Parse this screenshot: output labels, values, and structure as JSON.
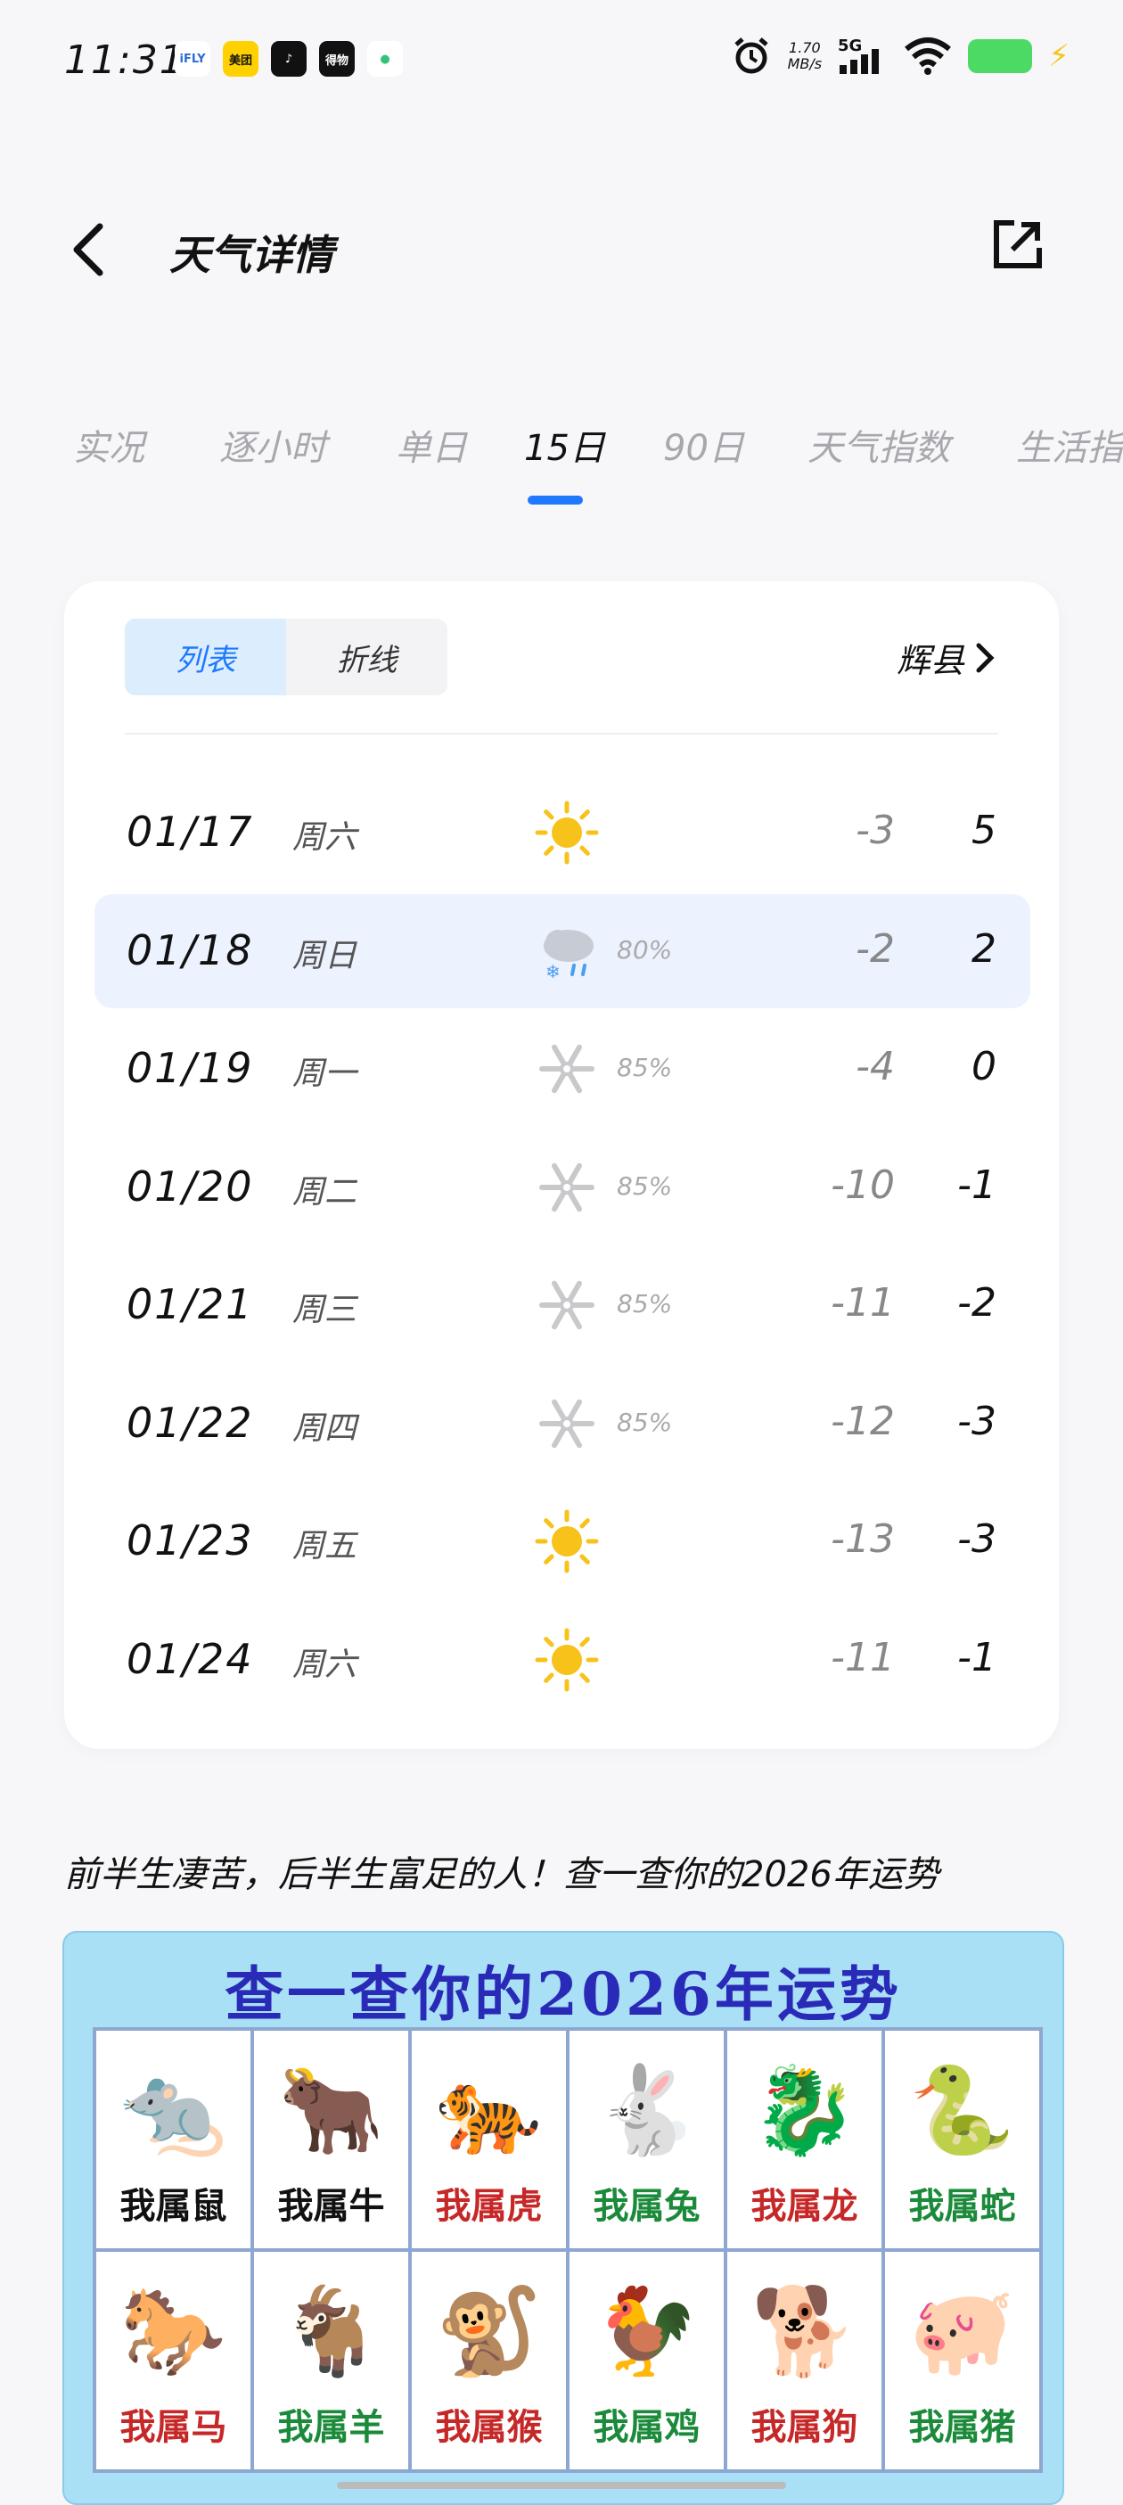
{
  "status": {
    "time": "11:31",
    "app_icons": [
      {
        "name": "ifly-icon",
        "text": "iFLY",
        "color": "#ffffff",
        "fg": "#2b6bd6"
      },
      {
        "name": "meituan-icon",
        "text": "美团",
        "color": "#ffd100",
        "fg": "#111111"
      },
      {
        "name": "douyin-icon",
        "text": "♪",
        "color": "#111111",
        "fg": "#ffffff"
      },
      {
        "name": "dewu-icon",
        "text": "得物",
        "color": "#111111",
        "fg": "#ffffff"
      },
      {
        "name": "green-app-icon",
        "text": "●",
        "color": "#ffffff",
        "fg": "#33c27a"
      }
    ],
    "speed_top": "1.70",
    "speed_bottom": "MB/s",
    "network": "5G"
  },
  "header": {
    "title": "天气详情"
  },
  "tabs": [
    {
      "label": "实况",
      "active": false
    },
    {
      "label": "逐小时",
      "active": false
    },
    {
      "label": "单日",
      "active": false
    },
    {
      "label": "15日",
      "active": true
    },
    {
      "label": "90日",
      "active": false
    },
    {
      "label": "天气指数",
      "active": false
    },
    {
      "label": "生活指数",
      "active": false
    }
  ],
  "segment": {
    "list": "列表",
    "line": "折线"
  },
  "location": "辉县",
  "forecast": [
    {
      "date": "01/17",
      "weekday": "周六",
      "icon": "sun",
      "pct": "",
      "low": "-3",
      "high": "5"
    },
    {
      "date": "01/18",
      "weekday": "周日",
      "icon": "sleet",
      "pct": "80%",
      "low": "-2",
      "high": "2"
    },
    {
      "date": "01/19",
      "weekday": "周一",
      "icon": "snow",
      "pct": "85%",
      "low": "-4",
      "high": "0"
    },
    {
      "date": "01/20",
      "weekday": "周二",
      "icon": "snow",
      "pct": "85%",
      "low": "-10",
      "high": "-1"
    },
    {
      "date": "01/21",
      "weekday": "周三",
      "icon": "snow",
      "pct": "85%",
      "low": "-11",
      "high": "-2"
    },
    {
      "date": "01/22",
      "weekday": "周四",
      "icon": "snow",
      "pct": "85%",
      "low": "-12",
      "high": "-3"
    },
    {
      "date": "01/23",
      "weekday": "周五",
      "icon": "sun",
      "pct": "",
      "low": "-13",
      "high": "-3"
    },
    {
      "date": "01/24",
      "weekday": "周六",
      "icon": "sun",
      "pct": "",
      "low": "-11",
      "high": "-1"
    }
  ],
  "promo_text": "前半生凄苦，后半生富足的人！查一查你的2026年运势",
  "ad": {
    "title": "查一查你的2026年运势",
    "zodiac": [
      {
        "label": "我属鼠",
        "glyph": "🐀",
        "color": "#111111"
      },
      {
        "label": "我属牛",
        "glyph": "🐂",
        "color": "#111111"
      },
      {
        "label": "我属虎",
        "glyph": "🐅",
        "color": "#c62828"
      },
      {
        "label": "我属兔",
        "glyph": "🐇",
        "color": "#1b8a3a"
      },
      {
        "label": "我属龙",
        "glyph": "🐉",
        "color": "#c62828"
      },
      {
        "label": "我属蛇",
        "glyph": "🐍",
        "color": "#1b8a3a"
      },
      {
        "label": "我属马",
        "glyph": "🐎",
        "color": "#c62828"
      },
      {
        "label": "我属羊",
        "glyph": "🐐",
        "color": "#1b8a3a"
      },
      {
        "label": "我属猴",
        "glyph": "🐒",
        "color": "#c62828"
      },
      {
        "label": "我属鸡",
        "glyph": "🐓",
        "color": "#1b8a3a"
      },
      {
        "label": "我属狗",
        "glyph": "🐕",
        "color": "#c62828"
      },
      {
        "label": "我属猪",
        "glyph": "🐖",
        "color": "#1b8a3a"
      }
    ]
  },
  "colors": {
    "accent": "#1e79ff",
    "highlight_row": "#ecf2fe",
    "sun": "#f7c21a",
    "snow": "#c9c9cc"
  }
}
